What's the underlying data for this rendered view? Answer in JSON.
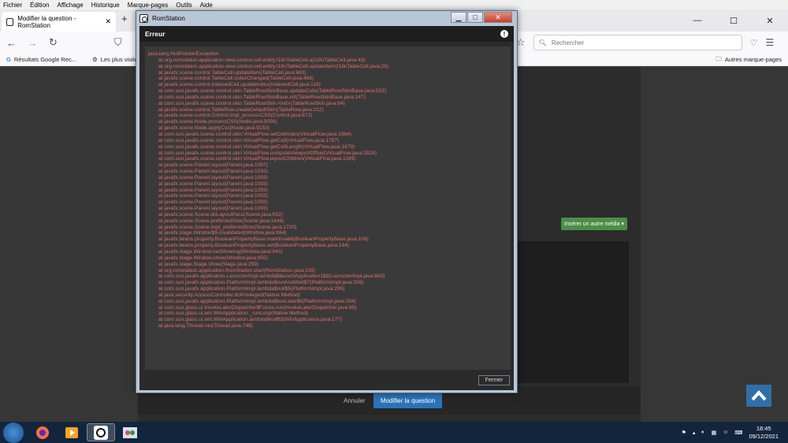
{
  "menu": [
    "Fichier",
    "Édition",
    "Affichage",
    "Historique",
    "Marque-pages",
    "Outils",
    "Aide"
  ],
  "browser_tab": {
    "title": "Modifier la question - RomStation"
  },
  "toolbar": {
    "search_placeholder": "Rechercher"
  },
  "bookmarks": {
    "items": [
      "Résultats Google Rec...",
      "Les plus visités"
    ],
    "other": "Autres marque-pages"
  },
  "page": {
    "media_button": "Insérer un autre média ▾",
    "cancel": "Annuler",
    "submit": "Modifier la question"
  },
  "dialog": {
    "window_title": "RomStation",
    "header": "Erreur",
    "close_button": "Fermer",
    "stacktrace": [
      "java.lang.NullPointerException",
      "at org.romstation.application.view.control.cell.entity.I18nTableCell.a(I18nTableCell.java:43)",
      "at org.romstation.application.view.control.cell.entity.I18nTableCell.updateItem(I18nTableCell.java:26)",
      "at javafx.scene.control.TableCell.updateItem(TableCell.java:663)",
      "at javafx.scene.control.TableCell.indexChanged(TableCell.java:468)",
      "at javafx.scene.control.IndexedCell.updateIndex(IndexedCell.java:116)",
      "at com.sun.javafx.scene.control.skin.TableRowSkinBase.updateCells(TableRowSkinBase.java:533)",
      "at com.sun.javafx.scene.control.skin.TableRowSkinBase.init(TableRowSkinBase.java:147)",
      "at com.sun.javafx.scene.control.skin.TableRowSkin.<init>(TableRowSkin.java:64)",
      "at javafx.scene.control.TableRow.createDefaultSkin(TableRow.java:212)",
      "at javafx.scene.control.Control.impl_processCSS(Control.java:872)",
      "at javafx.scene.Node.processCSS(Node.java:9056)",
      "at javafx.scene.Node.applyCss(Node.java:9153)",
      "at com.sun.javafx.scene.control.skin.VirtualFlow.setCellIndex(VirtualFlow.java:1964)",
      "at com.sun.javafx.scene.control.skin.VirtualFlow.getCell(VirtualFlow.java:1797)",
      "at com.sun.javafx.scene.control.skin.VirtualFlow.getCellLength(VirtualFlow.java:1879)",
      "at com.sun.javafx.scene.control.skin.VirtualFlow.computeViewportOffset(VirtualFlow.java:2528)",
      "at com.sun.javafx.scene.control.skin.VirtualFlow.layoutChildren(VirtualFlow.java:1189)",
      "at javafx.scene.Parent.layout(Parent.java:1087)",
      "at javafx.scene.Parent.layout(Parent.java:1093)",
      "at javafx.scene.Parent.layout(Parent.java:1093)",
      "at javafx.scene.Parent.layout(Parent.java:1093)",
      "at javafx.scene.Parent.layout(Parent.java:1093)",
      "at javafx.scene.Parent.layout(Parent.java:1093)",
      "at javafx.scene.Parent.layout(Parent.java:1093)",
      "at javafx.scene.Parent.layout(Parent.java:1093)",
      "at javafx.scene.Scene.doLayoutPass(Scene.java:552)",
      "at javafx.scene.Scene.preferredSize(Scene.java:1646)",
      "at javafx.scene.Scene.impl_preferredSize(Scene.java:1720)",
      "at javafx.stage.Window$9.invalidated(Window.java:864)",
      "at javafx.beans.property.BooleanPropertyBase.markInvalid(BooleanPropertyBase.java:109)",
      "at javafx.beans.property.BooleanPropertyBase.set(BooleanPropertyBase.java:144)",
      "at javafx.stage.Window.setShowing(Window.java:940)",
      "at javafx.stage.Window.show(Window.java:955)",
      "at javafx.stage.Stage.show(Stage.java:259)",
      "at org.romstation.application.RomStation.start(RomStation.java:155)",
      "at com.sun.javafx.application.LauncherImpl.lambda$launchApplication1$8(LauncherImpl.java:863)",
      "at com.sun.javafx.application.PlatformImpl.lambda$runAndWait$7(PlatformImpl.java:326)",
      "at com.sun.javafx.application.PlatformImpl.lambda$null$5(PlatformImpl.java:295)",
      "at java.security.AccessController.doPrivileged(Native Method)",
      "at com.sun.javafx.application.PlatformImpl.lambda$runLater$6(PlatformImpl.java:294)",
      "at com.sun.glass.ui.InvokeLaterDispatcher$Future.run(InvokeLaterDispatcher.java:95)",
      "at com.sun.glass.ui.win.WinApplication._runLoop(Native Method)",
      "at com.sun.glass.ui.win.WinApplication.lambda$null$3(WinApplication.java:177)",
      "at java.lang.Thread.run(Thread.java:748)"
    ]
  },
  "taskbar": {
    "time": "18:45",
    "date": "09/12/2021"
  },
  "colors": {
    "error_text": "#e86b6b",
    "accent_green": "#4b8e48",
    "accent_blue": "#2a73b8"
  }
}
